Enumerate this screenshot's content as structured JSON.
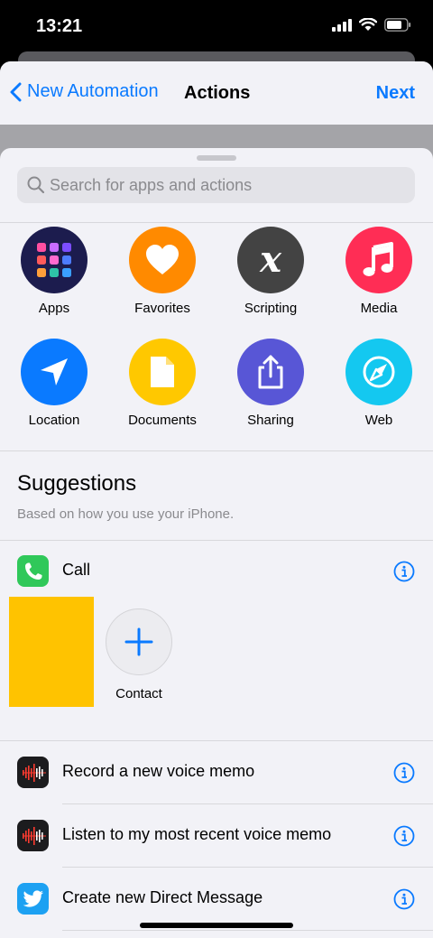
{
  "status_bar": {
    "time": "13:21"
  },
  "nav": {
    "back_label": "New Automation",
    "title": "Actions",
    "next_label": "Next"
  },
  "search": {
    "placeholder": "Search for apps and actions"
  },
  "categories": [
    {
      "label": "Apps",
      "icon": "apps-grid-icon",
      "color": "#1c1c4e"
    },
    {
      "label": "Favorites",
      "icon": "heart-icon",
      "color": "#ff8a00"
    },
    {
      "label": "Scripting",
      "icon": "scripting-x-icon",
      "color": "#434343"
    },
    {
      "label": "Media",
      "icon": "music-note-icon",
      "color": "#ff2d55"
    },
    {
      "label": "Location",
      "icon": "location-arrow-icon",
      "color": "#0a7aff"
    },
    {
      "label": "Documents",
      "icon": "document-icon",
      "color": "#ffc800"
    },
    {
      "label": "Sharing",
      "icon": "share-icon",
      "color": "#5856d6"
    },
    {
      "label": "Web",
      "icon": "compass-icon",
      "color": "#14c8f0"
    }
  ],
  "suggestions": {
    "title": "Suggestions",
    "subtitle": "Based on how you use your iPhone.",
    "call": {
      "label": "Call",
      "icon": "phone-icon",
      "color": "#30c85a"
    },
    "contact_label": "Contact",
    "items": [
      {
        "label": "Record a new voice memo",
        "icon": "voice-memo-icon"
      },
      {
        "label": "Listen to my most recent voice memo",
        "icon": "voice-memo-icon"
      },
      {
        "label": "Create new Direct Message",
        "icon": "twitter-icon"
      }
    ]
  },
  "colors": {
    "accent": "#0a7aff"
  }
}
